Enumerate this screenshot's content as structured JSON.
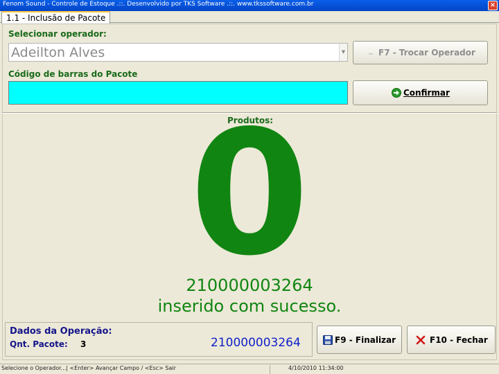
{
  "window": {
    "title": "Fenom Sound - Controle de Estoque .::. Desenvolvido por TKS Software .::. www.tkssoftware.com.br",
    "close_glyph": "×"
  },
  "tab": {
    "label": "1.1 - Inclusão de Pacote"
  },
  "operator": {
    "label": "Selecionar operador:",
    "selected": "Adeilton Alves",
    "change_button": "F7 - Trocar Operador"
  },
  "barcode": {
    "label": "Código de barras do Pacote",
    "value": "",
    "confirm_button": "Confirmar",
    "confirm_icon": "green-arrow-icon"
  },
  "products": {
    "label": "Produtos:",
    "count": "0",
    "last_code": "210000003264",
    "message": "inserido com sucesso."
  },
  "operation": {
    "label": "Dados da Operação:",
    "qty_label": "Qnt. Pacote:",
    "qty_value": "3",
    "last_code": "210000003264"
  },
  "actions": {
    "finalize": "F9 - Finalizar",
    "finalize_icon": "floppy-disk-icon",
    "close": "F10 - Fechar",
    "close_icon": "red-x-icon"
  },
  "status": {
    "hint": "Selecione o Operador...| <Enter> Avançar Campo / <Esc> Sair",
    "datetime": "4/10/2010 11:34:00"
  },
  "colors": {
    "accent_green": "#118511",
    "barcode_bg": "#00ffff",
    "code_blue": "#1020c8"
  }
}
